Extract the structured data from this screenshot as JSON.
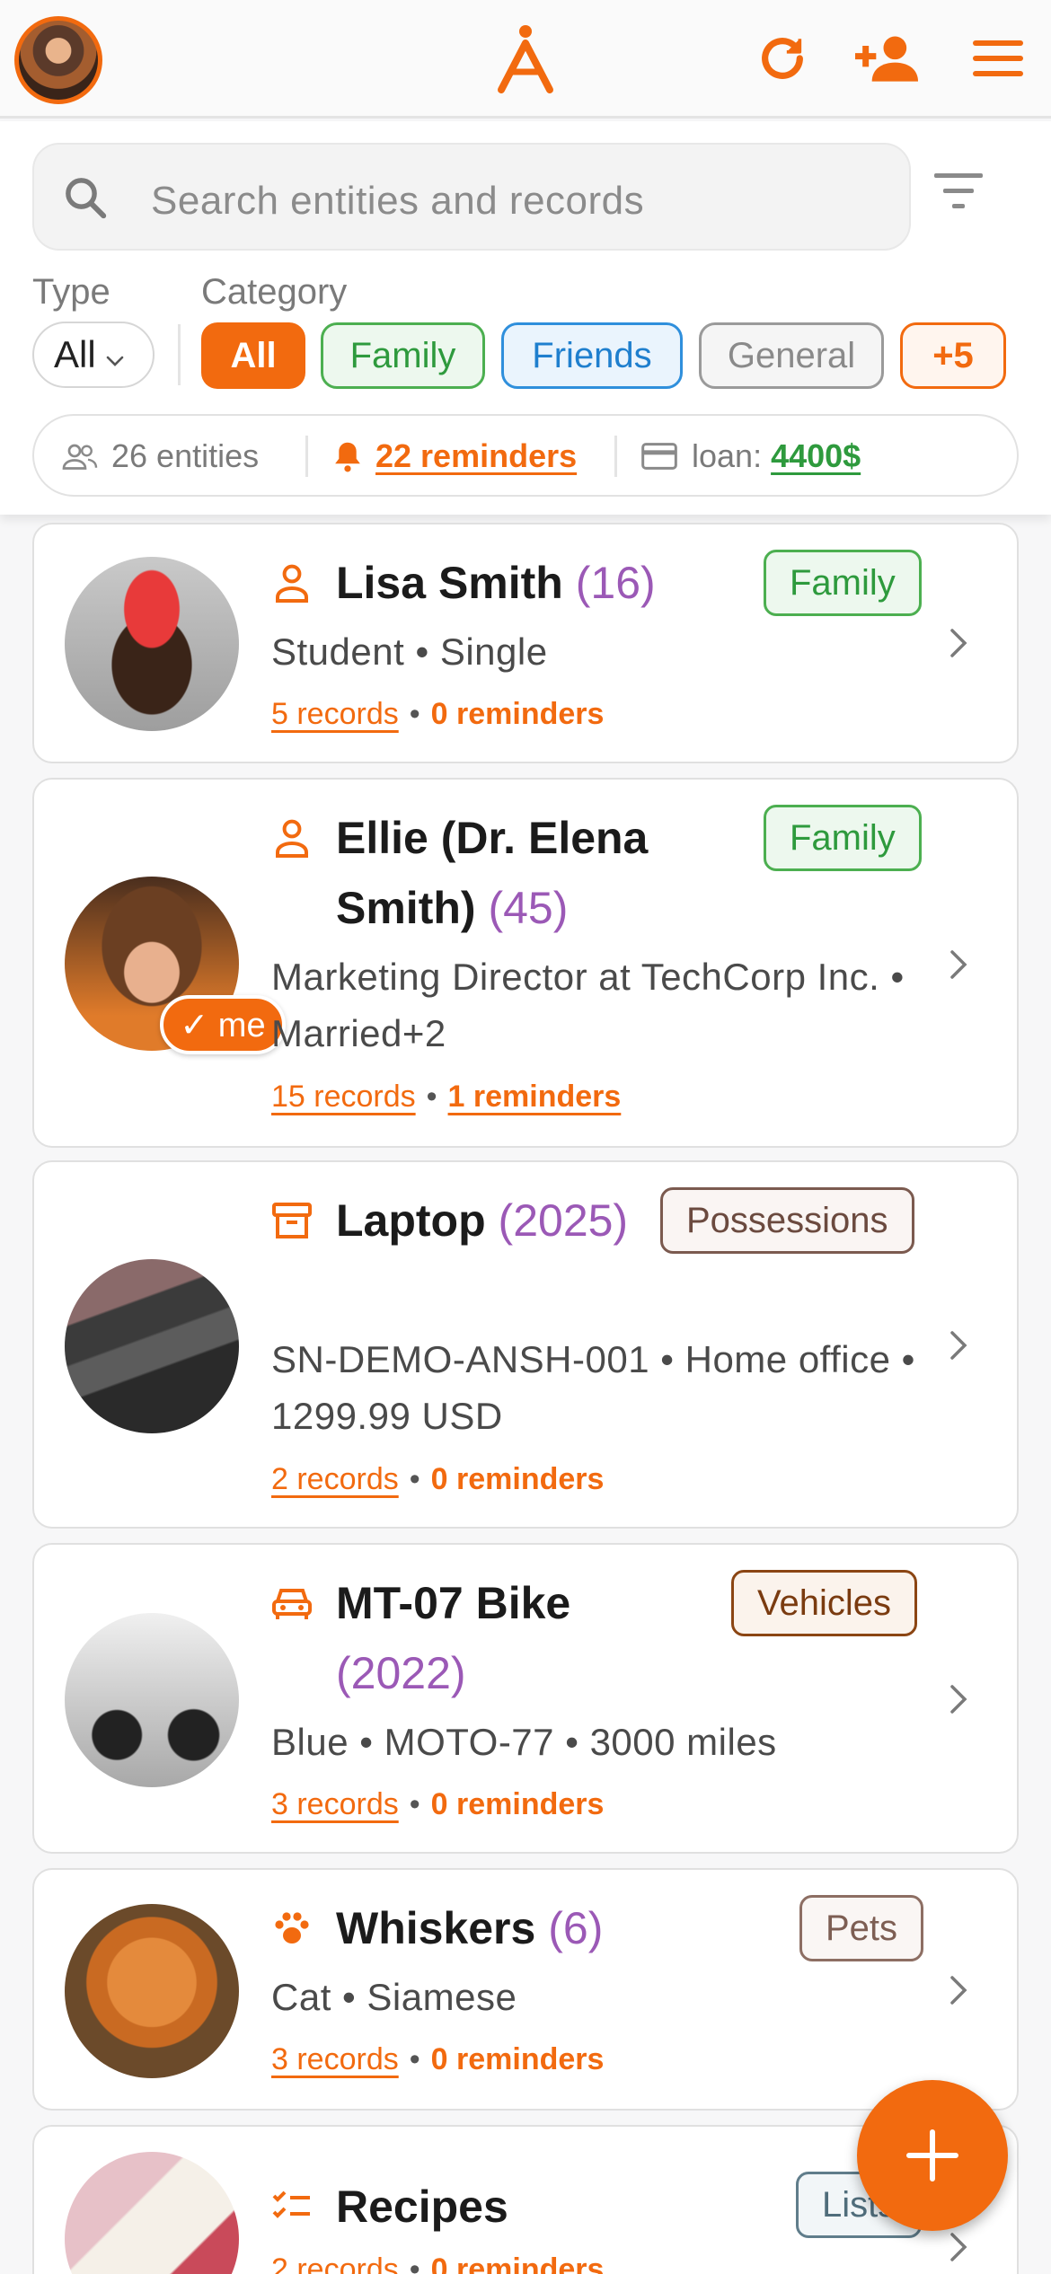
{
  "header": {
    "search_placeholder": "Search entities and records",
    "type_label": "Type",
    "type_value": "All",
    "category_label": "Category",
    "categories": [
      "All",
      "Family",
      "Friends",
      "General",
      "+5"
    ],
    "stats": {
      "entities": "26 entities",
      "reminders": "22 reminders",
      "loan_label": "loan:",
      "loan_value": "4400$"
    }
  },
  "colors": {
    "accent": "#f26a0f",
    "age": "#9b59b6",
    "green": "#2e9a3d"
  },
  "entities": [
    {
      "icon": "person-icon",
      "name": "Lisa Smith",
      "age": "(16)",
      "tag": "Family",
      "sub": "Student • Single",
      "records": "5 records",
      "reminders": "0 reminders"
    },
    {
      "icon": "person-icon",
      "name": "Ellie (Dr. Elena Smith)",
      "age": "(45)",
      "tag": "Family",
      "sub": "Marketing Director at TechCorp Inc. • Married+2",
      "records": "15 records",
      "reminders": "1 reminders",
      "badge": "✓ me"
    },
    {
      "icon": "archive-icon",
      "name": "Laptop",
      "age": "(2025)",
      "tag": "Possessions",
      "sub": "SN-DEMO-ANSH-001 • Home office • 1299.99 USD",
      "records": "2 records",
      "reminders": "0 reminders"
    },
    {
      "icon": "car-icon",
      "name": "MT-07 Bike",
      "age": "(2022)",
      "tag": "Vehicles",
      "sub": "Blue • MOTO-77 • 3000 miles",
      "records": "3 records",
      "reminders": "0 reminders"
    },
    {
      "icon": "paw-icon",
      "name": "Whiskers",
      "age": "(6)",
      "tag": "Pets",
      "sub": "Cat • Siamese",
      "records": "3 records",
      "reminders": "0 reminders"
    },
    {
      "icon": "checklist-icon",
      "name": "Recipes",
      "age": "",
      "tag": "Lists",
      "sub": "",
      "records": "2 records",
      "reminders": "0 reminders"
    }
  ]
}
